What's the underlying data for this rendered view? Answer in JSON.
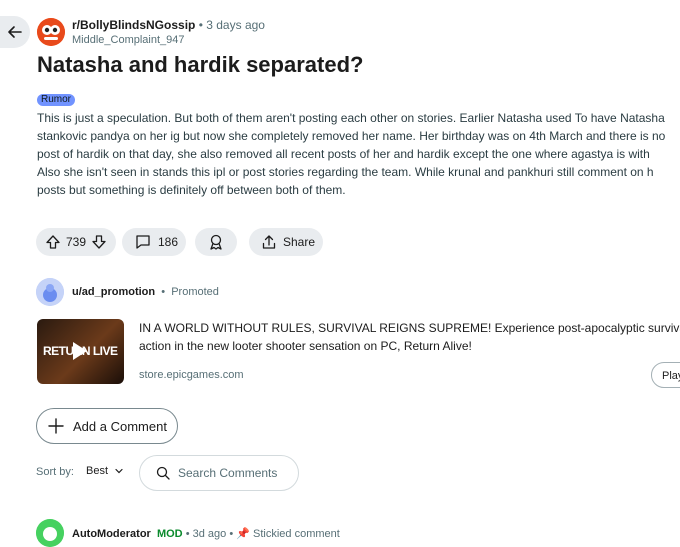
{
  "post": {
    "subreddit": "r/BollyBlindsNGossip",
    "time": "3 days ago",
    "author": "Middle_Complaint_947",
    "title": "Natasha and hardik separated?",
    "flair": "Rumor",
    "body_lines": [
      "This is just a speculation. But both of them aren't posting each other on stories. Earlier Natasha used To have Natasha",
      "stankovic pandya on her ig but now she completely removed her name. Her birthday was on 4th March and there is no",
      "post of hardik on that day, she also removed all recent posts of her and hardik except the one where agastya is with",
      "Also she isn't seen in stands this ipl or post stories regarding the team. While krunal and pankhuri still comment on h",
      "posts but something is definitely off between both of them."
    ],
    "votes": "739",
    "comments": "186",
    "share_label": "Share"
  },
  "ad": {
    "user": "u/ad_promotion",
    "promoted": "Promoted",
    "thumb_text": "RETURN LIVE",
    "headline_lines": [
      "IN A WORLD WITHOUT RULES, SURVIVAL REIGNS SUPREME! Experience post-apocalyptic survival",
      "action in the new looter shooter sensation on PC, Return Alive!"
    ],
    "domain": "store.epicgames.com",
    "cta": "Play"
  },
  "comments_section": {
    "add_comment_label": "Add a Comment",
    "sort_label": "Sort by:",
    "sort_value": "Best",
    "search_placeholder": "Search Comments"
  },
  "first_comment": {
    "author": "AutoModerator",
    "badge": "MOD",
    "time": "3d ago",
    "stickied": "Stickied comment"
  },
  "colors": {
    "accent": "#ff4500",
    "flair_bg": "#7193ff",
    "mod_green": "#0a8a2c",
    "pill_bg": "#e9ecef"
  },
  "icons": [
    "back-arrow-icon",
    "upvote-icon",
    "downvote-icon",
    "comment-icon",
    "award-icon",
    "share-icon",
    "play-icon",
    "plus-icon",
    "chevron-down-icon",
    "search-icon",
    "pin-icon"
  ]
}
